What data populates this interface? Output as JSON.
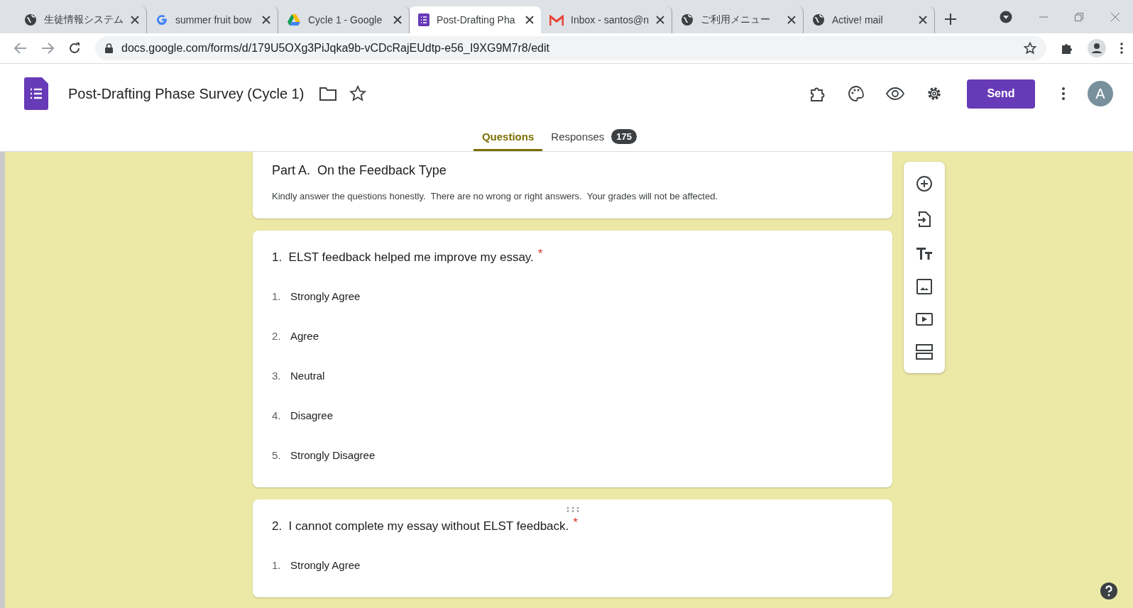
{
  "browser": {
    "tabs": [
      {
        "title": "生徒情報システム",
        "kind": "globe",
        "selected": false
      },
      {
        "title": "summer fruit bow",
        "kind": "google",
        "selected": false
      },
      {
        "title": "Cycle 1 - Google",
        "kind": "drive",
        "selected": false
      },
      {
        "title": "Post-Drafting Pha",
        "kind": "forms",
        "selected": true
      },
      {
        "title": "Inbox - santos@n",
        "kind": "gmail",
        "selected": false
      },
      {
        "title": "ご利用メニュー",
        "kind": "globe",
        "selected": false
      },
      {
        "title": "Active! mail",
        "kind": "globe",
        "selected": false
      }
    ],
    "url": "docs.google.com/forms/d/179U5OXg3PiJqka9b-vCDcRajEUdtp-e56_I9XG9M7r8/edit"
  },
  "header": {
    "title": "Post-Drafting Phase Survey (Cycle 1)",
    "send": "Send",
    "avatar": "A",
    "tabs": [
      {
        "label": "Questions",
        "selected": true
      },
      {
        "label": "Responses",
        "selected": false,
        "count": "175"
      }
    ]
  },
  "section": {
    "title": "Part A.  On the Feedback Type",
    "description": "Kindly answer the questions honestly.  There are no wrong or right answers.  Your grades will not be affected."
  },
  "questions": [
    {
      "text": "1.  ELST feedback helped me improve my essay.",
      "required_mark": "*",
      "options": [
        {
          "number": "1.",
          "label": "Strongly Agree"
        },
        {
          "number": "2.",
          "label": "Agree"
        },
        {
          "number": "3.",
          "label": "Neutral"
        },
        {
          "number": "4.",
          "label": "Disagree"
        },
        {
          "number": "5.",
          "label": "Strongly Disagree"
        }
      ]
    },
    {
      "text": "2.  I cannot complete my essay without ELST feedback.",
      "required_mark": "*",
      "options": [
        {
          "number": "1.",
          "label": "Strongly Agree"
        }
      ]
    }
  ]
}
